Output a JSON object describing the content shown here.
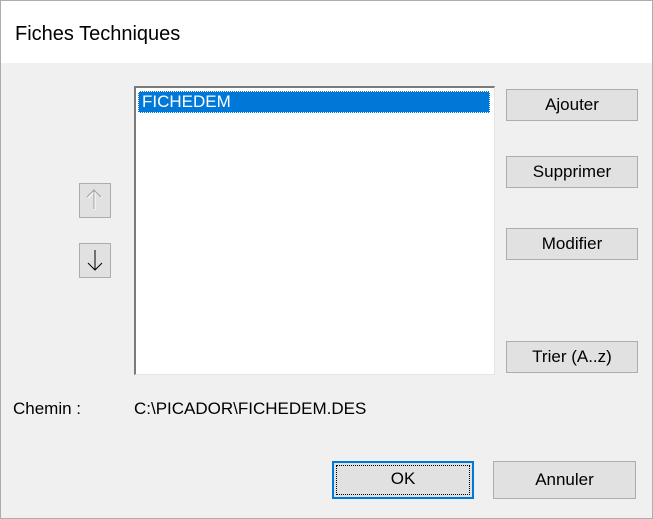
{
  "window": {
    "title": "Fiches Techniques"
  },
  "list": {
    "items": [
      {
        "label": "FICHEDEM",
        "selected": true
      }
    ]
  },
  "buttons": {
    "ajouter": "Ajouter",
    "supprimer": "Supprimer",
    "modifier": "Modifier",
    "trier": "Trier (A..z)",
    "ok": "OK",
    "annuler": "Annuler"
  },
  "arrows": {
    "up_icon": "arrow-up-icon",
    "down_icon": "arrow-down-icon",
    "up_enabled": false,
    "down_enabled": true
  },
  "path": {
    "label": "Chemin :",
    "value": "C:\\PICADOR\\FICHEDEM.DES"
  },
  "colors": {
    "selection": "#0078d7",
    "button_face": "#e1e1e1",
    "window_bg": "#f0f0f0",
    "focus_border": "#0078d7"
  }
}
